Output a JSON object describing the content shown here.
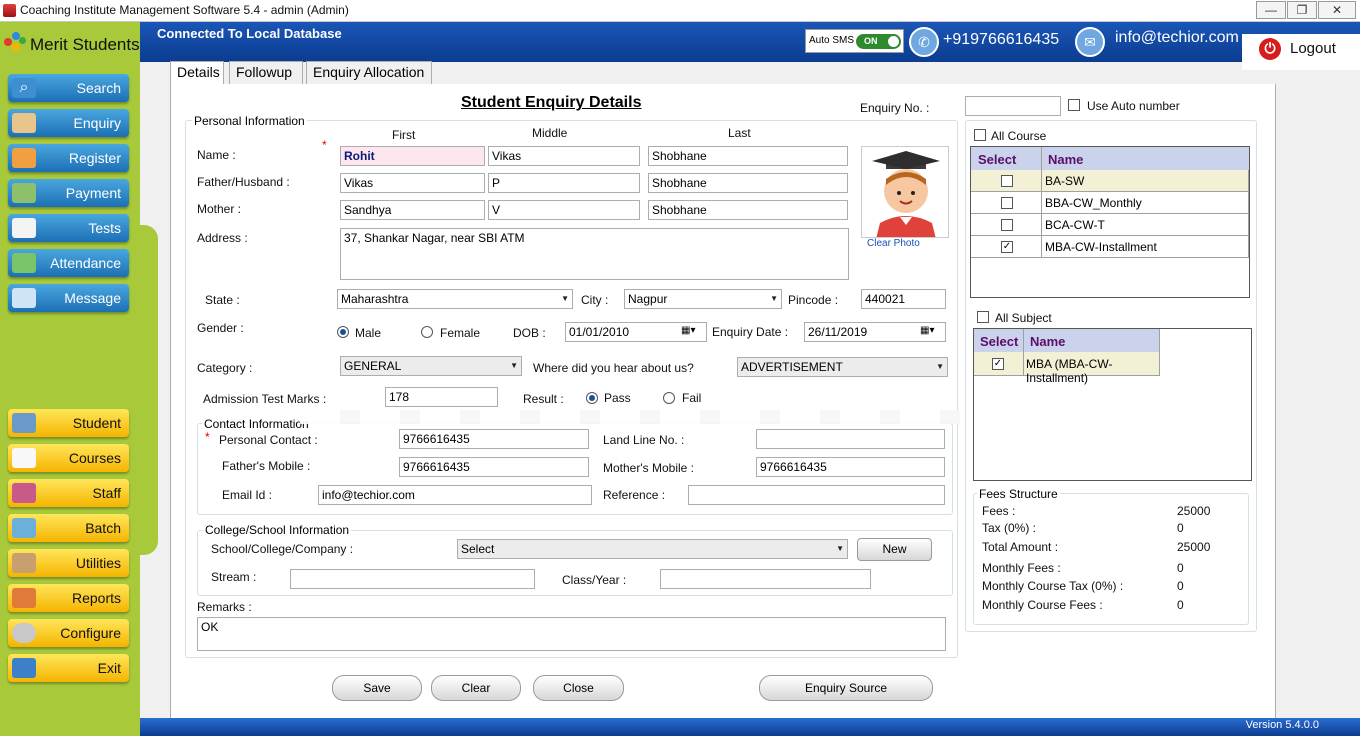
{
  "window": {
    "title": "Coaching Institute Management Software 5.4  -  admin (Admin)",
    "min": "—",
    "max": "❐",
    "close": "✕"
  },
  "sidebar": {
    "brand": "Merit Students",
    "top_items": [
      {
        "label": "Search",
        "icon": "search-icon"
      },
      {
        "label": "Enquiry",
        "icon": "enquiry-icon"
      },
      {
        "label": "Register",
        "icon": "register-icon"
      },
      {
        "label": "Payment",
        "icon": "payment-icon"
      },
      {
        "label": "Tests",
        "icon": "tests-icon"
      },
      {
        "label": "Attendance",
        "icon": "attendance-icon"
      },
      {
        "label": "Message",
        "icon": "message-icon"
      }
    ],
    "bottom_items": [
      {
        "label": "Student",
        "icon": "student-icon"
      },
      {
        "label": "Courses",
        "icon": "courses-icon"
      },
      {
        "label": "Staff",
        "icon": "staff-icon"
      },
      {
        "label": "Batch",
        "icon": "batch-icon"
      },
      {
        "label": "Utilities",
        "icon": "utilities-icon"
      },
      {
        "label": "Reports",
        "icon": "reports-icon"
      },
      {
        "label": "Configure",
        "icon": "configure-icon"
      },
      {
        "label": "Exit",
        "icon": "exit-icon"
      }
    ]
  },
  "header": {
    "connection": "Connected To  Local Database",
    "auto_sms": "Auto SMS",
    "toggle": "ON",
    "phone": "+919766616435",
    "email": "info@techior.com",
    "logout": "Logout"
  },
  "tabs": [
    "Details",
    "Followup",
    "Enquiry Allocation"
  ],
  "form": {
    "title": "Student Enquiry Details",
    "enquiry_no_label": "Enquiry No. :",
    "enquiry_no": "",
    "use_auto_number": "Use Auto number",
    "personal_info": "Personal Information",
    "col_first": "First",
    "col_middle": "Middle",
    "col_last": "Last",
    "name_label": "Name :",
    "name_first": "Rohit",
    "name_middle": "Vikas",
    "name_last": "Shobhane",
    "father_label": "Father/Husband :",
    "father_first": "Vikas",
    "father_middle": "P",
    "father_last": "Shobhane",
    "mother_label": "Mother :",
    "mother_first": "Sandhya",
    "mother_middle": "V",
    "mother_last": "Shobhane",
    "address_label": "Address :",
    "address": "37, Shankar Nagar, near SBI ATM",
    "clear_photo": "Clear Photo",
    "state_label": "State :",
    "state": "Maharashtra",
    "city_label": "City :",
    "city": "Nagpur",
    "pincode_label": "Pincode :",
    "pincode": "440021",
    "gender_label": "Gender :",
    "male": "Male",
    "female": "Female",
    "dob_label": "DOB :",
    "dob": "01/01/2010",
    "enquiry_date_label": "Enquiry Date :",
    "enquiry_date": "26/11/2019",
    "category_label": "Category :",
    "category": "GENERAL",
    "hear_label": "Where did you hear about us?",
    "hear": "ADVERTISEMENT",
    "test_marks_label": "Admission Test Marks :",
    "test_marks": "178",
    "result_label": "Result :",
    "pass": "Pass",
    "fail": "Fail",
    "contact_info": "Contact Information",
    "personal_contact_label": "Personal Contact :",
    "personal_contact": "9766616435",
    "land_line_label": "Land Line No. :",
    "land_line": "",
    "father_mobile_label": "Father's Mobile :",
    "father_mobile": "9766616435",
    "mother_mobile_label": "Mother's Mobile :",
    "mother_mobile": "9766616435",
    "email_label": "Email Id :",
    "email": "info@techior.com",
    "reference_label": "Reference :",
    "reference": "",
    "college_info": "College/School Information",
    "school_label": "School/College/Company :",
    "school": "Select",
    "new_button": "New",
    "stream_label": "Stream :",
    "stream": "",
    "class_label": "Class/Year :",
    "class_year": "",
    "remarks_label": "Remarks :",
    "remarks": "OK",
    "save": "Save",
    "clear": "Clear",
    "close": "Close",
    "enquiry_source": "Enquiry Source"
  },
  "courses": {
    "all_label": "All Course",
    "col_select": "Select",
    "col_name": "Name",
    "rows": [
      {
        "name": "BA-SW",
        "checked": false
      },
      {
        "name": "BBA-CW_Monthly",
        "checked": false
      },
      {
        "name": "BCA-CW-T",
        "checked": false
      },
      {
        "name": "MBA-CW-Installment",
        "checked": true
      }
    ]
  },
  "subjects": {
    "all_label": "All Subject",
    "col_select": "Select",
    "col_name": "Name",
    "rows": [
      {
        "name": "MBA (MBA-CW-Installment)",
        "checked": true
      }
    ]
  },
  "fees": {
    "title": "Fees Structure",
    "rows": [
      {
        "label": "Fees :",
        "value": "25000"
      },
      {
        "label": "Tax (0%) :",
        "value": "0"
      },
      {
        "label": "Total Amount :",
        "value": "25000"
      },
      {
        "label": "Monthly Fees :",
        "value": "0"
      },
      {
        "label": "Monthly Course Tax (0%) :",
        "value": "0"
      },
      {
        "label": "Monthly Course Fees :",
        "value": "0"
      }
    ]
  },
  "version": "Version 5.4.0.0"
}
